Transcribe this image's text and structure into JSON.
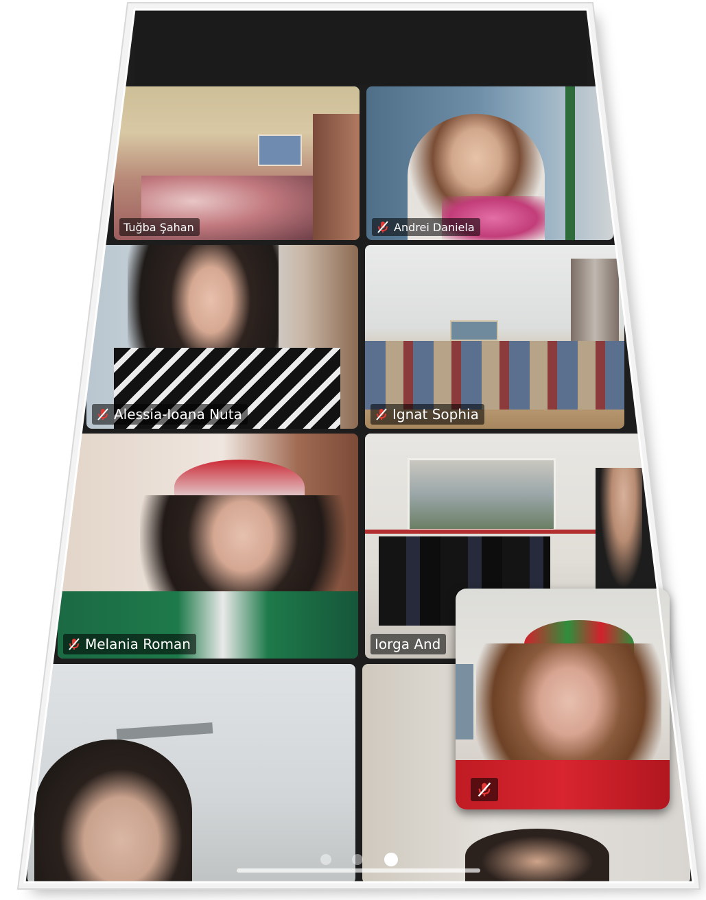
{
  "participants": [
    {
      "name": "Tuğba Şahan",
      "muted": false,
      "active_speaker": true
    },
    {
      "name": "Andrei Daniela",
      "muted": true,
      "active_speaker": false
    },
    {
      "name": "Alessia-Ioana Nuta",
      "muted": true,
      "active_speaker": false
    },
    {
      "name": "Ignat Sophia",
      "muted": true,
      "active_speaker": false
    },
    {
      "name": "Melania Roman",
      "muted": true,
      "active_speaker": false
    },
    {
      "name": "Iorga And",
      "muted": false,
      "active_speaker": false
    },
    {
      "name": "",
      "muted": false,
      "active_speaker": false
    },
    {
      "name": "",
      "muted": false,
      "active_speaker": false
    }
  ],
  "self_view": {
    "name": "",
    "muted": true
  },
  "pagination": {
    "pages": 3,
    "current": 3
  },
  "icons": {
    "mute": "mic-muted-icon",
    "camera": "camera-dot-icon"
  },
  "colors": {
    "active_border": "#2ecc52",
    "muted_icon": "#e53935",
    "background": "#1d1d1d",
    "name_tag_bg": "rgba(0,0,0,0.55)"
  }
}
